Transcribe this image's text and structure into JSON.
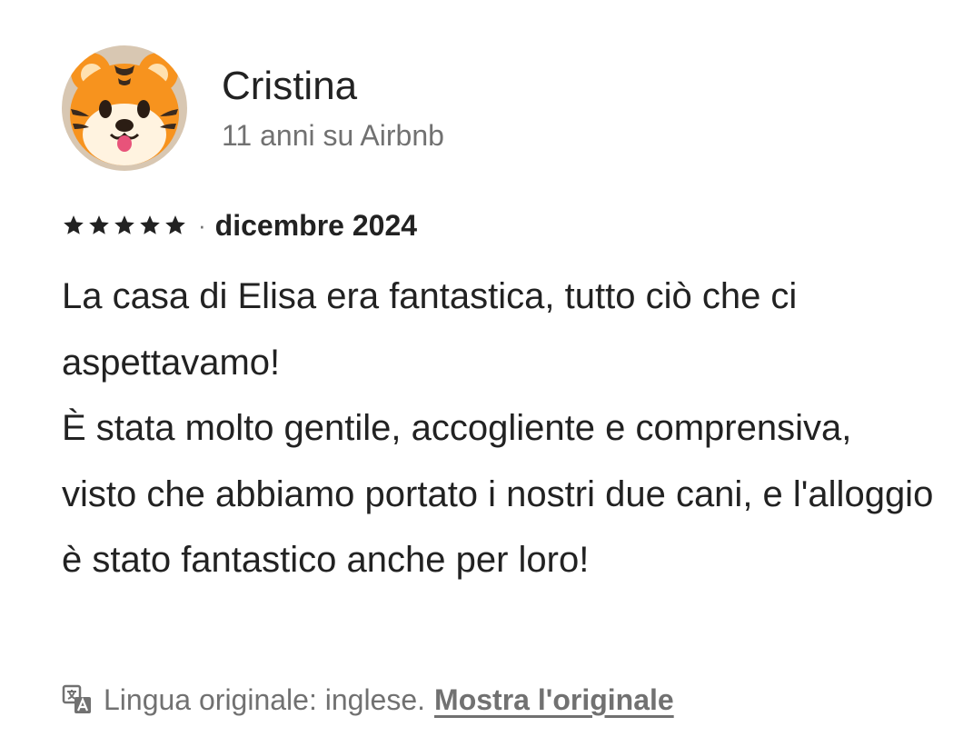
{
  "reviewer": {
    "name": "Cristina",
    "tenure": "11 anni su Airbnb",
    "avatar_icon": "tiger-face-emoji"
  },
  "review": {
    "rating": 5,
    "rating_max": 5,
    "separator": "·",
    "date": "dicembre 2024",
    "paragraphs": [
      "La casa di Elisa era fantastica, tutto ciò che ci aspettavamo!",
      "È stata molto gentile, accogliente e comprensiva, visto che abbiamo portato i nostri due cani, e l'alloggio è stato fantastico anche per loro!"
    ]
  },
  "translation": {
    "icon": "translate-icon",
    "text": "Lingua originale: inglese.",
    "link_label": "Mostra l'originale"
  },
  "colors": {
    "primary_text": "#222222",
    "secondary_text": "#717171",
    "background": "#ffffff"
  }
}
